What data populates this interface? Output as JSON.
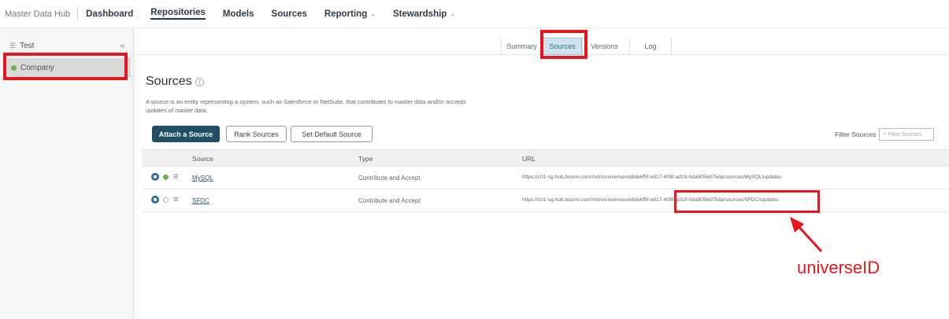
{
  "topnav": {
    "brand": "Master Data Hub",
    "items": [
      {
        "label": "Dashboard"
      },
      {
        "label": "Repositories"
      },
      {
        "label": "Models"
      },
      {
        "label": "Sources"
      },
      {
        "label": "Reporting"
      },
      {
        "label": "Stewardship"
      }
    ],
    "active_item": "Repositories"
  },
  "sidebar": {
    "items": [
      {
        "label": "Test"
      },
      {
        "label": "Company"
      }
    ],
    "selected": "Company"
  },
  "tabs": [
    {
      "label": "Summary"
    },
    {
      "label": "Sources"
    },
    {
      "label": "Versions"
    },
    {
      "label": "Log"
    }
  ],
  "active_tab": "Sources",
  "page": {
    "title": "Sources",
    "description": "A source is an entity representing a system, such as Salesforce or NetSuite, that contributes to master data and/or accepts updates of master data."
  },
  "buttons": {
    "attach": "Attach a Source",
    "rank": "Rank Sources",
    "default": "Set Default Source"
  },
  "filter": {
    "label": "Filter Sources",
    "placeholder": "Filter Sources"
  },
  "table": {
    "columns": [
      "Source",
      "Type",
      "URL"
    ],
    "rows": [
      {
        "source": "MySQL",
        "type": "Contribute and Accept",
        "url": "https://c01-sg.hub.boomi.com/mdm/universes/e8de6f5f-e817-409f-ad19-0da8056d75da/sources/MySQL/updates",
        "status": "active"
      },
      {
        "source": "SFDC",
        "type": "Contribute and Accept",
        "url": "https://c01-sg.hub.boomi.com/mdm/universes/e8de6f5f-e817-409f-ad19-0da8056d75da/sources/SFDC/updates",
        "status": "inactive"
      }
    ]
  },
  "annotation": {
    "label": "universeID",
    "color": "#e8151c"
  }
}
